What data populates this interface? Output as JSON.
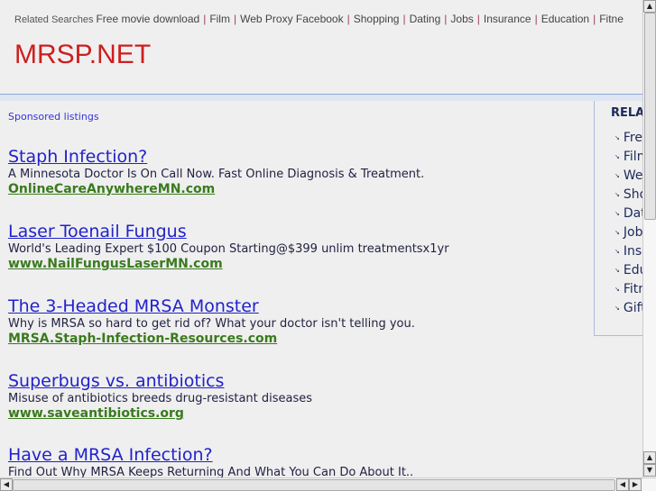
{
  "related_bar": {
    "label": "Related Searches",
    "links": [
      "Free movie download",
      "Film",
      "Web Proxy Facebook",
      "Shopping",
      "Dating",
      "Jobs",
      "Insurance",
      "Education",
      "Fitne"
    ]
  },
  "logo": "MRSP.NET",
  "sponsored_label": "Sponsored listings",
  "ads": [
    {
      "title": "Staph Infection?",
      "desc": "A Minnesota Doctor Is On Call Now. Fast Online Diagnosis & Treatment.",
      "url": "OnlineCareAnywhereMN.com"
    },
    {
      "title": "Laser Toenail Fungus",
      "desc": "World's Leading Expert $100 Coupon Starting@$399 unlim treatmentsx1yr",
      "url": "www.NailFungusLaserMN.com"
    },
    {
      "title": "The 3-Headed MRSA Monster",
      "desc": "Why is MRSA so hard to get rid of? What your doctor isn't telling you.",
      "url": "MRSA.Staph-Infection-Resources.com"
    },
    {
      "title": "Superbugs vs. antibiotics",
      "desc": "Misuse of antibiotics breeds drug-resistant diseases",
      "url": "www.saveantibiotics.org"
    },
    {
      "title": "Have a MRSA Infection?",
      "desc": "Find Out Why MRSA Keeps Returning And What You Can Do About It..",
      "url": ""
    }
  ],
  "sidebar": {
    "title": "RELATED",
    "items": [
      "Free",
      "Film",
      "Web",
      "Shopping",
      "Dating",
      "Jobs",
      "Insurance",
      "Education",
      "Fitness",
      "Gifts"
    ]
  }
}
